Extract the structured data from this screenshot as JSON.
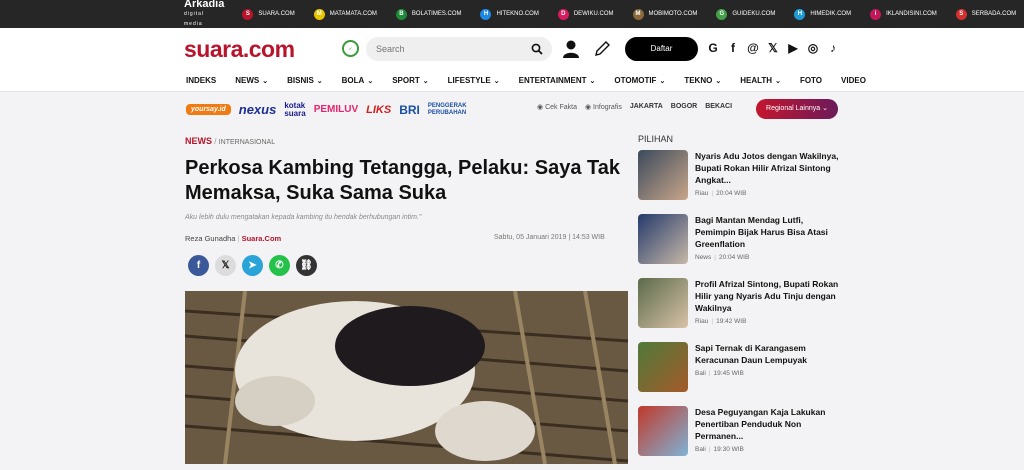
{
  "network": {
    "brand": "Arkadia",
    "brand_sub": "digital media",
    "sites": [
      {
        "label": "SUARA.COM",
        "icon": "S",
        "color": "#b8142c"
      },
      {
        "label": "MATAMATA.COM",
        "icon": "M",
        "color": "#e9c400"
      },
      {
        "label": "BOLATIMES.COM",
        "icon": "B",
        "color": "#1d8a3a"
      },
      {
        "label": "HITEKNO.COM",
        "icon": "H",
        "color": "#1e88e5"
      },
      {
        "label": "DEWIKU.COM",
        "icon": "D",
        "color": "#d81b60"
      },
      {
        "label": "MOBIMOTO.COM",
        "icon": "M",
        "color": "#8a6a3a"
      },
      {
        "label": "GUIDEKU.COM",
        "icon": "G",
        "color": "#43a047"
      },
      {
        "label": "HIMEDIK.COM",
        "icon": "H",
        "color": "#1e9bd7"
      },
      {
        "label": "IKLANDISINI.COM",
        "icon": "i",
        "color": "#c2185b"
      },
      {
        "label": "SERBADA.COM",
        "icon": "S",
        "color": "#d32f2f"
      }
    ]
  },
  "header": {
    "logo": "suara.com",
    "search_placeholder": "Search",
    "register_label": "Daftar"
  },
  "nav": [
    {
      "label": "INDEKS",
      "dropdown": false
    },
    {
      "label": "NEWS",
      "dropdown": true
    },
    {
      "label": "BISNIS",
      "dropdown": true
    },
    {
      "label": "BOLA",
      "dropdown": true
    },
    {
      "label": "SPORT",
      "dropdown": true
    },
    {
      "label": "LIFESTYLE",
      "dropdown": true
    },
    {
      "label": "ENTERTAINMENT",
      "dropdown": true
    },
    {
      "label": "OTOMOTIF",
      "dropdown": true
    },
    {
      "label": "TEKNO",
      "dropdown": true
    },
    {
      "label": "HEALTH",
      "dropdown": true
    },
    {
      "label": "FOTO",
      "dropdown": false
    },
    {
      "label": "VIDEO",
      "dropdown": false
    }
  ],
  "partners": {
    "yoursay": "yoursay.id",
    "nexus": "nexus",
    "kotak_1": "kotak",
    "kotak_2": "suara",
    "pemiluv": "PEMILUV",
    "liks": "LIKS",
    "bri": "BRI",
    "peng_1": "PENGGERAK",
    "peng_2": "PERUBAHAN"
  },
  "quick_links": {
    "cek_fakta": "Cek Fakta",
    "infografis": "Infografis",
    "jakarta": "JAKARTA",
    "bogor": "BOGOR",
    "bekasi": "BEKACI",
    "regional": "Regional Lainnya"
  },
  "article": {
    "category": "NEWS",
    "subcategory": "INTERNASIONAL",
    "title": "Perkosa Kambing Tetangga, Pelaku: Saya Tak Memaksa, Suka Sama Suka",
    "lead": "Aku lebih dulu mengatakan kepada kambing itu hendak berhubungan intim.\"",
    "author": "Reza Gunadha",
    "publisher": "Suara.Com",
    "date": "Sabtu, 05 Januari 2019 | 14:53 WIB"
  },
  "sidebar": {
    "title": "PILIHAN",
    "items": [
      {
        "title": "Nyaris Adu Jotos dengan Wakilnya, Bupati Rokan Hilir Afrizal Sintong Angkat...",
        "region": "Riau",
        "time": "20:04 WIB"
      },
      {
        "title": "Bagi Mantan Mendag Lutfi, Pemimpin Bijak Harus Bisa Atasi Greenflation",
        "region": "News",
        "time": "20:04 WIB"
      },
      {
        "title": "Profil Afrizal Sintong, Bupati Rokan Hilir yang Nyaris Adu Tinju dengan Wakilnya",
        "region": "Riau",
        "time": "19:42 WIB"
      },
      {
        "title": "Sapi Ternak di Karangasem Keracunan Daun Lempuyak",
        "region": "Bali",
        "time": "19:45 WIB"
      },
      {
        "title": "Desa Peguyangan Kaja Lakukan Penertiban Penduduk Non Permanen...",
        "region": "Bali",
        "time": "19:30 WIB"
      }
    ]
  }
}
